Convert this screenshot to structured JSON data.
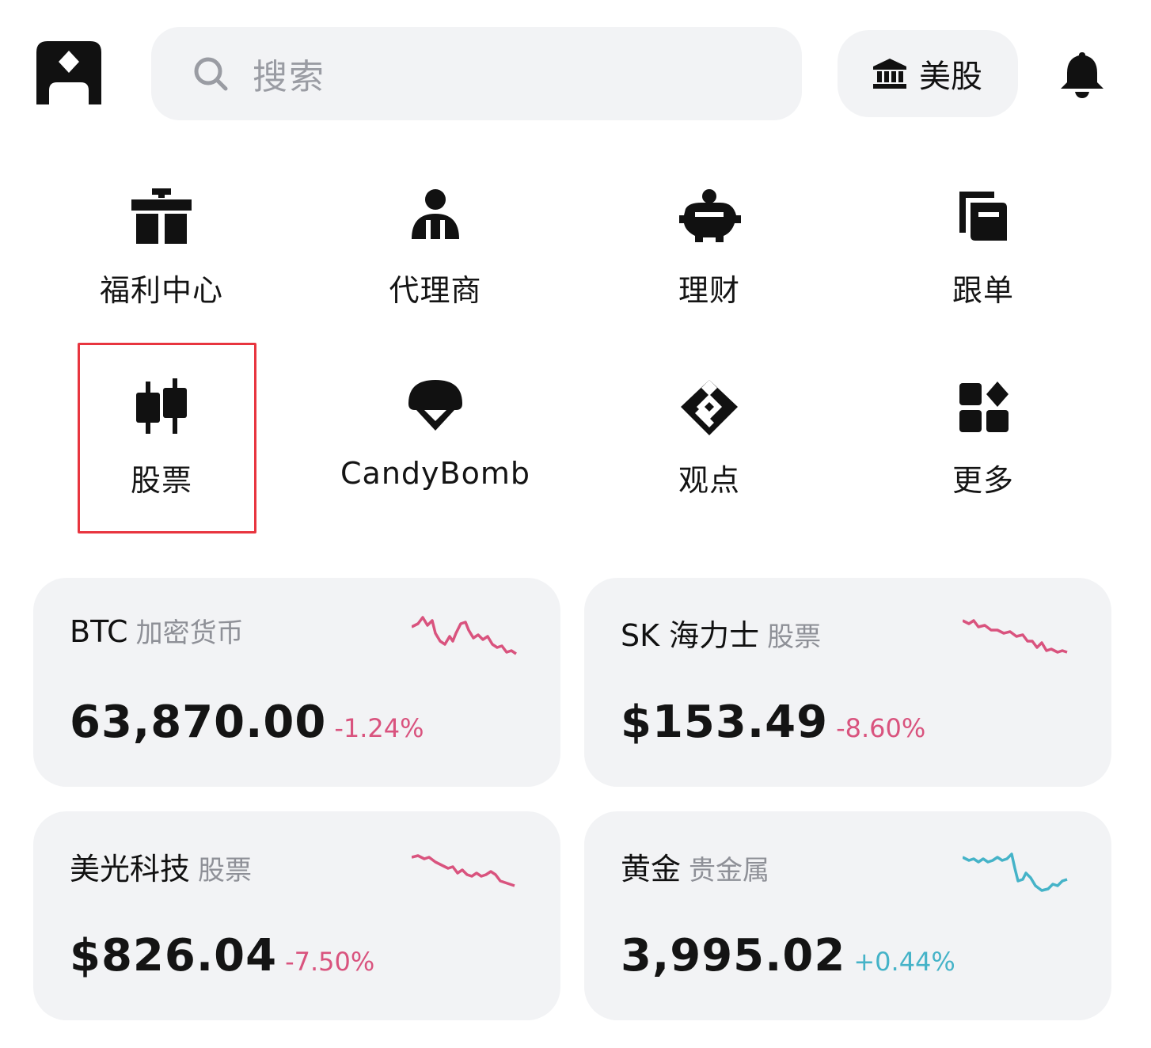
{
  "header": {
    "search_placeholder": "搜索",
    "market_label": "美股"
  },
  "shortcuts": [
    {
      "label": "福利中心",
      "icon": "gift-icon"
    },
    {
      "label": "代理商",
      "icon": "agent-icon"
    },
    {
      "label": "理财",
      "icon": "piggy-bank-icon"
    },
    {
      "label": "跟单",
      "icon": "copy-trade-icon"
    },
    {
      "label": "股票",
      "icon": "candlestick-icon"
    },
    {
      "label": "CandyBomb",
      "icon": "parachute-icon"
    },
    {
      "label": "观点",
      "icon": "insight-icon"
    },
    {
      "label": "更多",
      "icon": "more-grid-icon"
    }
  ],
  "colors": {
    "down": "#d9537e",
    "up": "#45b3c8",
    "highlight": "#e8353f",
    "card_bg": "#f2f3f5"
  },
  "cards": [
    {
      "symbol": "BTC",
      "category": "加密货币",
      "price": "63,870.00",
      "change": "-1.24%",
      "direction": "down"
    },
    {
      "symbol": "SK 海力士",
      "category": "股票",
      "price": "$153.49",
      "change": "-8.60%",
      "direction": "down"
    },
    {
      "symbol": "美光科技",
      "category": "股票",
      "price": "$826.04",
      "change": "-7.50%",
      "direction": "down"
    },
    {
      "symbol": "黄金",
      "category": "贵金属",
      "price": "3,995.02",
      "change": "+0.44%",
      "direction": "up"
    }
  ]
}
